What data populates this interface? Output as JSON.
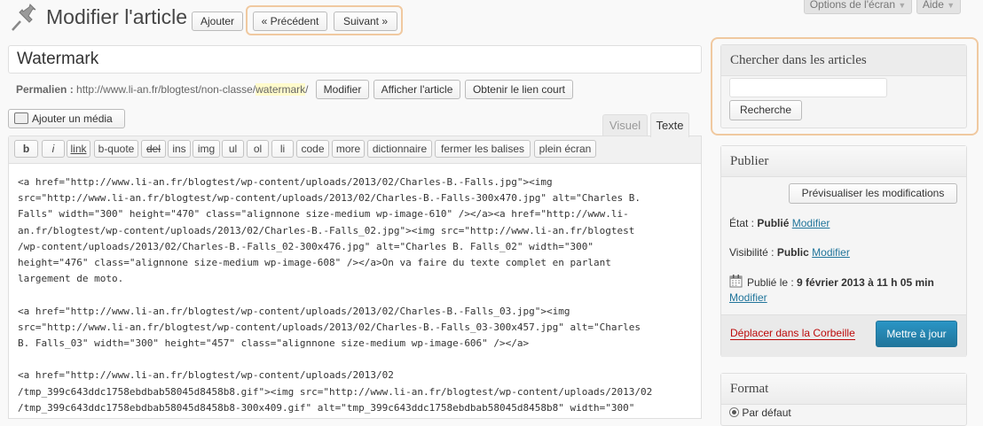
{
  "screen_options": "Options de l'écran",
  "help": "Aide",
  "page_title": "Modifier l'article",
  "add_new": "Ajouter",
  "prev": "« Précédent",
  "next": "Suivant »",
  "post_title": "Watermark",
  "permalink": {
    "label": "Permalien :",
    "url_prefix": "http://www.li-an.fr/blogtest/non-classe/",
    "slug": "watermark",
    "url_suffix": "/",
    "edit": "Modifier",
    "view": "Afficher l'article",
    "shortlink": "Obtenir le lien court"
  },
  "add_media": "Ajouter un média",
  "tabs": {
    "visual": "Visuel",
    "text": "Texte"
  },
  "quicktags": [
    "b",
    "i",
    "link",
    "b-quote",
    "del",
    "ins",
    "img",
    "ul",
    "ol",
    "li",
    "code",
    "more",
    "dictionnaire",
    "fermer les balises",
    "plein écran"
  ],
  "content_lines": [
    "<a href=\"http://www.li-an.fr/blogtest/wp-content/uploads/2013/02/Charles-B.-Falls.jpg\"><img",
    "src=\"http://www.li-an.fr/blogtest/wp-content/uploads/2013/02/Charles-B.-Falls-300x470.jpg\" alt=\"Charles B.",
    "Falls\" width=\"300\" height=\"470\" class=\"alignnone size-medium wp-image-610\" /></a><a href=\"http://www.li-",
    "an.fr/blogtest/wp-content/uploads/2013/02/Charles-B.-Falls_02.jpg\"><img src=\"http://www.li-an.fr/blogtest",
    "/wp-content/uploads/2013/02/Charles-B.-Falls_02-300x476.jpg\" alt=\"Charles B. Falls_02\" width=\"300\"",
    "height=\"476\" class=\"alignnone size-medium wp-image-608\" /></a>On va faire du texte complet en parlant",
    "largement de moto.",
    "",
    "<a href=\"http://www.li-an.fr/blogtest/wp-content/uploads/2013/02/Charles-B.-Falls_03.jpg\"><img",
    "src=\"http://www.li-an.fr/blogtest/wp-content/uploads/2013/02/Charles-B.-Falls_03-300x457.jpg\" alt=\"Charles",
    "B. Falls_03\" width=\"300\" height=\"457\" class=\"alignnone size-medium wp-image-606\" /></a>",
    "",
    "<a href=\"http://www.li-an.fr/blogtest/wp-content/uploads/2013/02",
    "/tmp_399c643ddc1758ebdbab58045d8458b8.gif\"><img src=\"http://www.li-an.fr/blogtest/wp-content/uploads/2013/02",
    "/tmp_399c643ddc1758ebdbab58045d8458b8-300x409.gif\" alt=\"tmp_399c643ddc1758ebdbab58045d8458b8\" width=\"300\""
  ],
  "search_box": {
    "title": "Chercher dans les articles",
    "value": "",
    "button": "Recherche"
  },
  "publish": {
    "title": "Publier",
    "preview": "Prévisualiser les modifications",
    "status_label": "État :",
    "status_value": "Publié",
    "visibility_label": "Visibilité :",
    "visibility_value": "Public",
    "published_label": "Publié le :",
    "published_date": "9 février 2013 à 11 h 05 min",
    "edit": "Modifier",
    "trash": "Déplacer dans la Corbeille",
    "update": "Mettre à jour"
  },
  "format_box": {
    "title": "Format",
    "first_option": "Par défaut"
  }
}
